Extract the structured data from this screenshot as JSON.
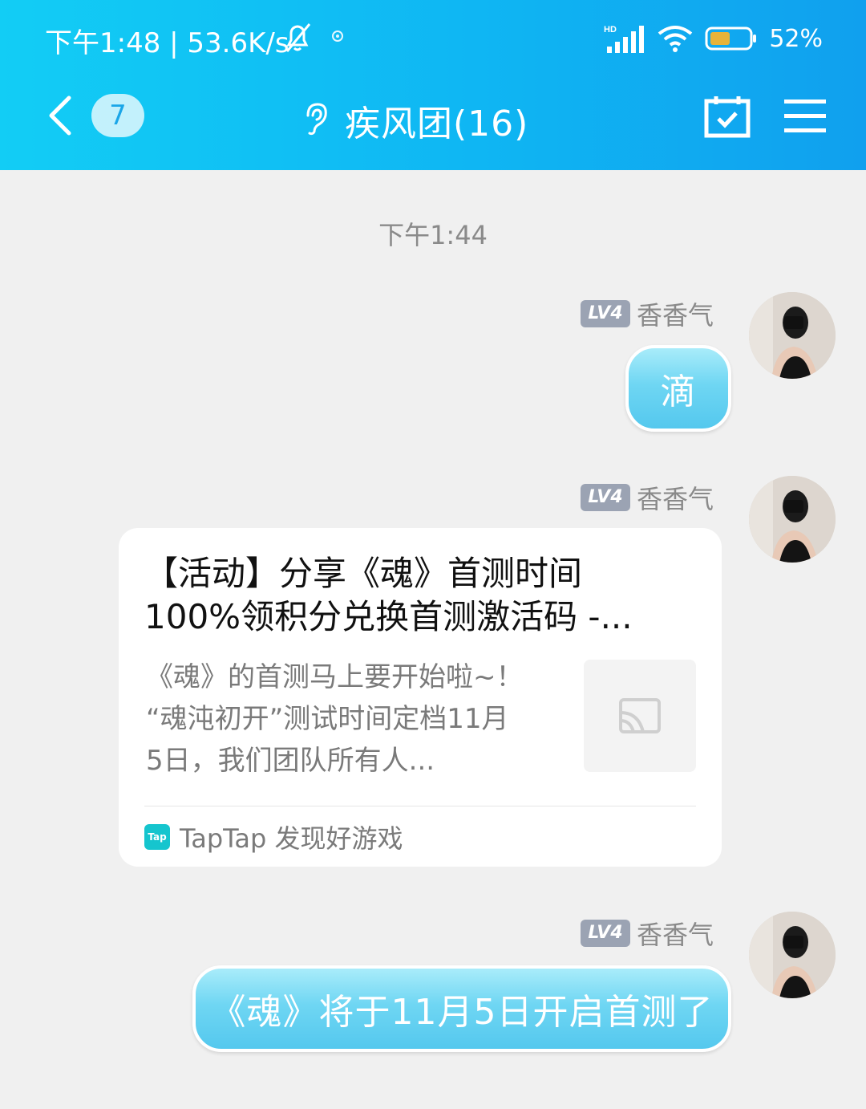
{
  "status_bar": {
    "time_speed": "下午1:48 | 53.6K/s",
    "battery": "52%",
    "signal_label": "HD"
  },
  "header": {
    "back_count": "7",
    "title": "疾风团(16)",
    "icons": [
      "chevron-left-icon",
      "ear-icon",
      "calendar-check-icon",
      "menu-icon"
    ]
  },
  "chat": {
    "timestamp": "下午1:44",
    "messages": [
      {
        "level": "LV4",
        "sender": "香香气",
        "text": "滴"
      },
      {
        "level": "LV4",
        "sender": "香香气",
        "card": {
          "title_line1": "【活动】分享《魂》首测时间",
          "title_line2": "100%领积分兑换首测激活码 -...",
          "desc_line1": "《魂》的首测马上要开始啦~！",
          "desc_line2": "“魂沌初开”测试时间定档11月",
          "desc_line3": "5日，我们团队所有人...",
          "logo_text": "Tap",
          "source": "TapTap 发现好游戏"
        }
      },
      {
        "level": "LV4",
        "sender": "香香气",
        "text": "《魂》将于11月5日开启首测了"
      }
    ]
  },
  "colors": {
    "header_start": "#12cdf5",
    "header_end": "#10a0ee",
    "bubble": "#54c8ee",
    "badge": "#9ba3b3"
  }
}
